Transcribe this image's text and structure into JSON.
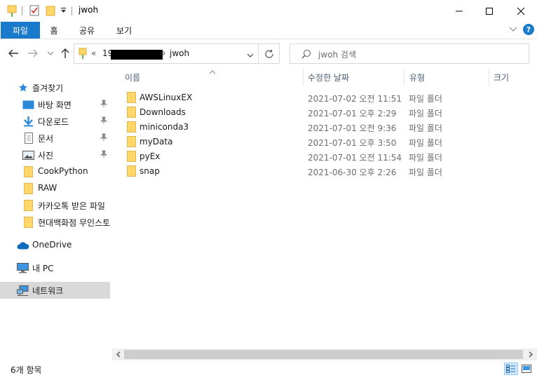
{
  "window": {
    "title": "jwoh"
  },
  "ribbon": {
    "tabs": [
      "파일",
      "홈",
      "공유",
      "보기"
    ]
  },
  "address": {
    "prefix": "«",
    "segment1": "19",
    "current": "jwoh"
  },
  "search": {
    "placeholder": "jwoh 검색"
  },
  "sidebar": {
    "items": [
      {
        "label": "즐겨찾기",
        "icon": "star-icon"
      },
      {
        "label": "바탕 화면",
        "icon": "desktop-icon",
        "pinned": true
      },
      {
        "label": "다운로드",
        "icon": "download-icon",
        "pinned": true
      },
      {
        "label": "문서",
        "icon": "document-icon",
        "pinned": true
      },
      {
        "label": "사진",
        "icon": "pictures-icon",
        "pinned": true
      },
      {
        "label": "CookPython",
        "icon": "folder-icon"
      },
      {
        "label": "RAW",
        "icon": "folder-icon"
      },
      {
        "label": "카카오톡 받은 파일",
        "icon": "folder-icon"
      },
      {
        "label": "현대백화점 무인스토",
        "icon": "folder-icon"
      },
      {
        "label": "OneDrive",
        "icon": "cloud-icon"
      },
      {
        "label": "내 PC",
        "icon": "pc-icon"
      },
      {
        "label": "네트워크",
        "icon": "network-icon",
        "selected": true
      }
    ]
  },
  "columns": {
    "name": "이름",
    "date": "수정한 날짜",
    "type": "유형",
    "size": "크기"
  },
  "files": [
    {
      "name": "AWSLinuxEX",
      "date": "2021-07-02 오전 11:51",
      "type": "파일 폴더"
    },
    {
      "name": "Downloads",
      "date": "2021-07-01 오후 2:29",
      "type": "파일 폴더"
    },
    {
      "name": "miniconda3",
      "date": "2021-07-01 오전 9:36",
      "type": "파일 폴더"
    },
    {
      "name": "myData",
      "date": "2021-07-01 오후 3:50",
      "type": "파일 폴더"
    },
    {
      "name": "pyEx",
      "date": "2021-07-01 오전 11:54",
      "type": "파일 폴더"
    },
    {
      "name": "snap",
      "date": "2021-06-30 오후 2:26",
      "type": "파일 폴더"
    }
  ],
  "status": {
    "count": "6개 항목"
  },
  "colors": {
    "accent": "#1979ca",
    "folder": "#ffd768",
    "selected_nav": "#d9d9d9"
  }
}
